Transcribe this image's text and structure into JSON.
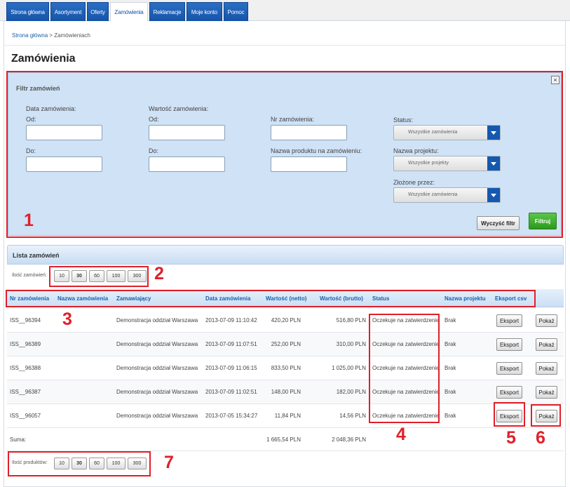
{
  "tabs": [
    {
      "label": "Strona główna",
      "active": false
    },
    {
      "label": "Asortyment",
      "active": false
    },
    {
      "label": "Oferty",
      "active": false
    },
    {
      "label": "Zamówienia",
      "active": true
    },
    {
      "label": "Reklamacje",
      "active": false
    },
    {
      "label": "Moje konto",
      "active": false
    },
    {
      "label": "Pomoc",
      "active": false
    }
  ],
  "breadcrumb": {
    "home": "Strona główna",
    "separator": " > ",
    "current": "Zamówieniach"
  },
  "page_title": "Zamówienia",
  "filter": {
    "title": "Filtr zamówień",
    "close": "×",
    "order_date_label": "Data zamówienia:",
    "order_value_label": "Wartość zamówienia:",
    "from_label": "Od:",
    "to_label": "Do:",
    "order_no_label": "Nr zamówienia:",
    "product_name_label": "Nazwa produktu na zamówieniu:",
    "status_label": "Status:",
    "status_value": "Wszystkie zamówienia",
    "project_label": "Nazwa projektu:",
    "project_value": "Wszystkie projekty",
    "placed_by_label": "Złożone przez:",
    "placed_by_value": "Wszystkie zamówienia",
    "clear_button": "Wyczyść filtr",
    "apply_button": "Filtruj"
  },
  "list": {
    "title": "Lista zamówień",
    "orders_count_label": "Ilość zamówień:",
    "products_count_label": "Ilość produktów:",
    "page_sizes": [
      "10",
      "30",
      "60",
      "100",
      "300"
    ],
    "selected_page_size": "30",
    "columns": [
      "Nr zamówienia",
      "Nazwa zamówienia",
      "Zamawiający",
      "Data zamówienia",
      "Wartość (netto)",
      "Wartość (brutto)",
      "Status",
      "Nazwa projektu",
      "Eksport csv"
    ],
    "rows": [
      {
        "nr": "ISS__96394",
        "name": "",
        "customer": "Demonstracja oddział Warszawa",
        "date": "2013-07-09 11:10:42",
        "net": "420,20 PLN",
        "gross": "516,80 PLN",
        "status": "Oczekuje na zatwierdzenie",
        "project": "Brak",
        "export": "Eksport",
        "show": "Pokaż"
      },
      {
        "nr": "ISS__96389",
        "name": "",
        "customer": "Demonstracja oddział Warszawa",
        "date": "2013-07-09 11:07:51",
        "net": "252,00 PLN",
        "gross": "310,00 PLN",
        "status": "Oczekuje na zatwierdzenie",
        "project": "Brak",
        "export": "Eksport",
        "show": "Pokaż"
      },
      {
        "nr": "ISS__96388",
        "name": "",
        "customer": "Demonstracja oddział Warszawa",
        "date": "2013-07-09 11:06:15",
        "net": "833,50 PLN",
        "gross": "1 025,00 PLN",
        "status": "Oczekuje na zatwierdzenie",
        "project": "Brak",
        "export": "Eksport",
        "show": "Pokaż"
      },
      {
        "nr": "ISS__96387",
        "name": "",
        "customer": "Demonstracja oddział Warszawa",
        "date": "2013-07-09 11:02:51",
        "net": "148,00 PLN",
        "gross": "182,00 PLN",
        "status": "Oczekuje na zatwierdzenie",
        "project": "Brak",
        "export": "Eksport",
        "show": "Pokaż"
      },
      {
        "nr": "ISS__96057",
        "name": "",
        "customer": "Demonstracja oddział Warszawa",
        "date": "2013-07-05 15:34:27",
        "net": "11,84 PLN",
        "gross": "14,56 PLN",
        "status": "Oczekuje na zatwierdzenie",
        "project": "Brak",
        "export": "Eksport",
        "show": "Pokaż"
      }
    ],
    "sum_label": "Suma:",
    "sum_net": "1 665,54 PLN",
    "sum_gross": "2 048,36 PLN"
  },
  "annotations": [
    "1",
    "2",
    "3",
    "4",
    "5",
    "6",
    "7"
  ],
  "colors": {
    "annotation": "#e0202a",
    "tab_blue": "#1553a8",
    "filter_bg": "#cfe2f6",
    "apply_green": "#2a9a1c"
  }
}
